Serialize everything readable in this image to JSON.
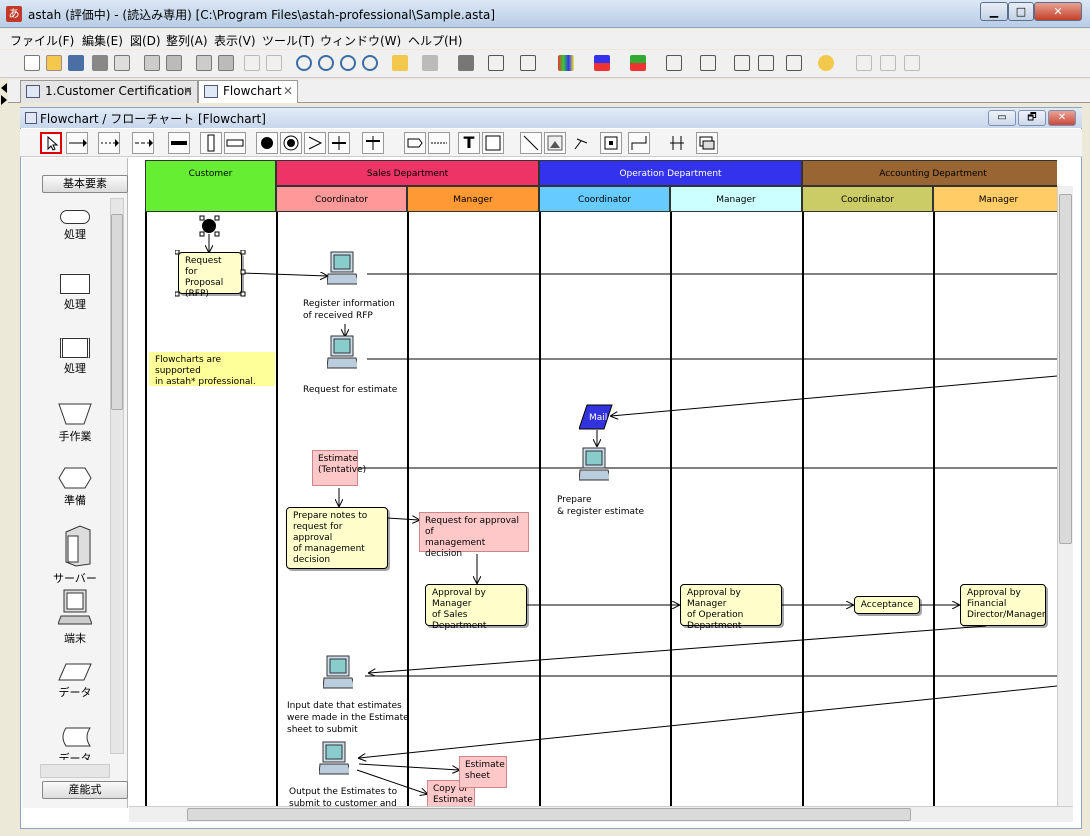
{
  "window": {
    "title": "astah (評価中) - (読込み専用) [C:\\Program Files\\astah-professional\\Sample.asta]",
    "app_icon": "あ"
  },
  "window_buttons": {
    "minimize": "▁",
    "maximize": "□",
    "close": "✕"
  },
  "menu": [
    "ファイル(F)",
    "編集(E)",
    "図(D)",
    "整列(A)",
    "表示(V)",
    "ツール(T)",
    "ウィンドウ(W)",
    "ヘルプ(H)"
  ],
  "tabs": [
    {
      "label": "1.Customer Certification",
      "close": "✕"
    },
    {
      "label": "Flowchart",
      "close": "✕"
    }
  ],
  "inner": {
    "title": "Flowchart / フローチャート [Flowchart]",
    "buttons": [
      "▭",
      "🗗",
      "✕"
    ]
  },
  "diagram_tools": {
    "text_tool": "T"
  },
  "palette": {
    "header_button": "基本要素",
    "items": [
      "処理",
      "処理",
      "処理",
      "手作業",
      "準備",
      "サーバー",
      "端末",
      "データ",
      "データ"
    ],
    "footer_button": "産能式"
  },
  "lanes": {
    "top": [
      {
        "label": "Customer",
        "color": "#66ee33"
      },
      {
        "label": "Sales Department",
        "color": "#ee3366"
      },
      {
        "label": "Operation Department",
        "color": "#3333ee"
      },
      {
        "label": "Accounting Department",
        "color": "#996633"
      }
    ],
    "sub": [
      {
        "label": "Coordinator",
        "color": "#ff9999"
      },
      {
        "label": "Manager",
        "color": "#ff9933"
      },
      {
        "label": "Coordinator",
        "color": "#66ccff"
      },
      {
        "label": "Manager",
        "color": "#ccffff"
      },
      {
        "label": "Coordinator",
        "color": "#cccc66"
      },
      {
        "label": "Manager",
        "color": "#ffcc66"
      }
    ]
  },
  "nodes": {
    "rfp": "Request for\nProposal\n(RFP)",
    "register": "Register information\nof received RFP",
    "note": "Flowcharts are supported\nin astah* professional.",
    "request_estimate": "Request for estimate",
    "mail": "Mail",
    "estimate_tentative": "Estimate\n(Tentative)",
    "prepare_register": "Prepare\n& register estimate",
    "prepare_notes": "Prepare notes to\nrequest for approval\nof management\ndecision",
    "request_approval": "Request for approval of\nmanagement decision",
    "approval_sales": "Approval by Manager\nof Sales Department",
    "approval_operation": "Approval by Manager\nof Operation\nDepartment",
    "acceptance": "Acceptance",
    "approval_financial": "Approval by\nFinancial\nDirector/Manager",
    "input_date": "Input date that estimates\nwere made in the Estimate\nsheet to submit",
    "output_estimates": "Output the Estimates to\nsubmit to customer and",
    "estimate_sheet": "Estimate\nsheet",
    "copy_estimate": "Copy of\nEstimate"
  }
}
